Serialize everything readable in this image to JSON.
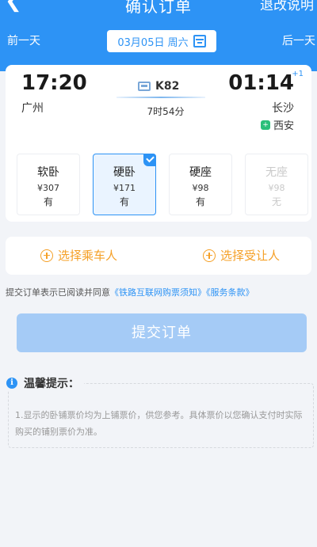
{
  "header": {
    "back_icon": "chevron-left-icon",
    "title": "确认订单",
    "refund_label": "退改说明",
    "prev_day": "前一天",
    "next_day": "后一天",
    "date": "03月05日 周六",
    "calendar_icon": "calendar-icon",
    "color": "#2d93f5"
  },
  "train": {
    "departure_time": "17:20",
    "departure_station": "广州",
    "arrival_time": "01:14",
    "arrival_day_offset": "+1",
    "arrival_station": "长沙",
    "via_station": "西安",
    "train_number": "K82",
    "duration": "7时54分"
  },
  "seats": [
    {
      "name": "软卧",
      "price": "¥307",
      "availability": "有",
      "selected": false,
      "disabled": false
    },
    {
      "name": "硬卧",
      "price": "¥171",
      "availability": "有",
      "selected": true,
      "disabled": false
    },
    {
      "name": "硬座",
      "price": "¥98",
      "availability": "有",
      "selected": false,
      "disabled": false
    },
    {
      "name": "无座",
      "price": "¥98",
      "availability": "无",
      "selected": false,
      "disabled": true
    }
  ],
  "passengers": {
    "select_passenger": "选择乘车人",
    "select_beneficiary": "选择受让人",
    "accent": "#f5a027"
  },
  "agreement": {
    "prefix": "提交订单表示已阅读并同意",
    "link1": "《铁路互联网购票须知》",
    "link2": "《服务条款》"
  },
  "submit_label": "提交订单",
  "tips": {
    "title": "温馨提示：",
    "text": "1.显示的卧铺票价均为上铺票价，供您参考。具体票价以您确认支付时实际购买的铺别票价为准。"
  }
}
